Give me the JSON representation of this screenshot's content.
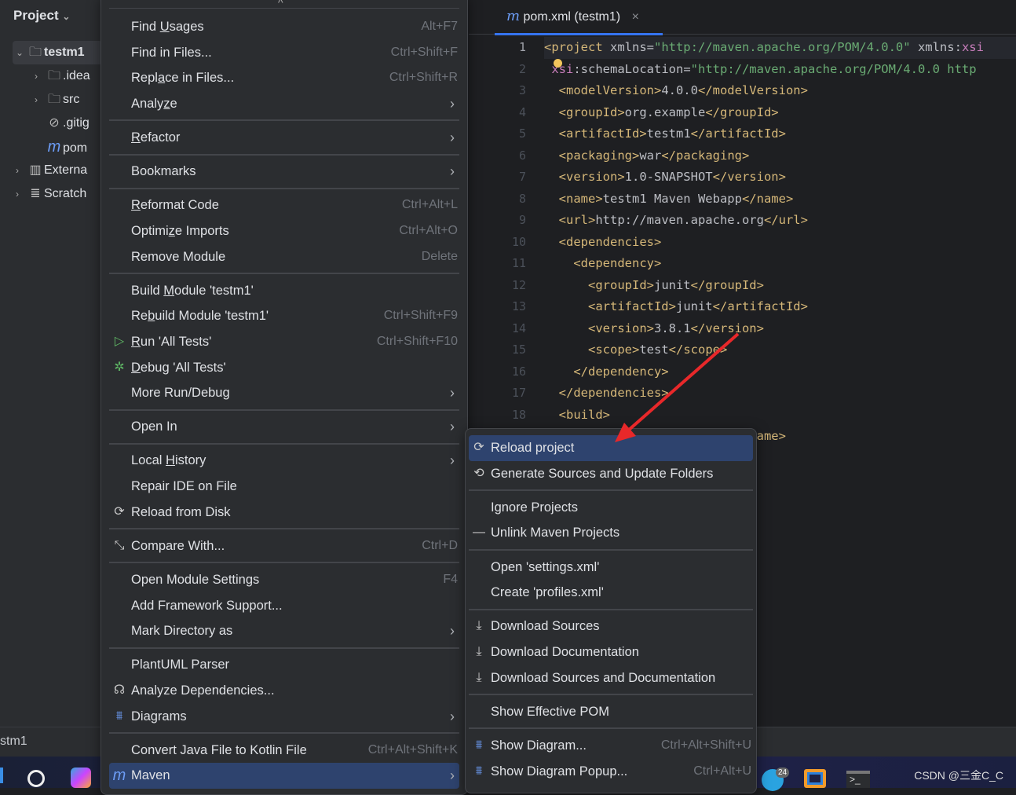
{
  "project_panel": {
    "title": "Project",
    "tree": [
      {
        "label": "testm1",
        "icon": "module-folder-icon",
        "depth": 0,
        "expanded": true,
        "selected": true
      },
      {
        "label": ".idea",
        "icon": "folder-icon",
        "depth": 1,
        "expanded": false
      },
      {
        "label": "src",
        "icon": "folder-icon",
        "depth": 1,
        "expanded": false
      },
      {
        "label": ".gitig",
        "icon": "ignored-file-icon",
        "depth": 1
      },
      {
        "label": "pom",
        "icon": "maven-icon",
        "depth": 1
      },
      {
        "label": "Externa",
        "icon": "library-icon",
        "depth": 0,
        "expanded": false
      },
      {
        "label": "Scratch",
        "icon": "scratch-icon",
        "depth": 0,
        "expanded": false
      }
    ]
  },
  "editor": {
    "tab": {
      "label": "pom.xml (testm1)",
      "icon": "maven-icon",
      "close": "×"
    },
    "lines": [
      [
        [
          "tg",
          "<project"
        ],
        [
          "at",
          " xmlns="
        ],
        [
          "st",
          "\"http://maven.apache.org/POM/4.0.0\""
        ],
        [
          "at",
          " xmlns:"
        ],
        [
          "ns",
          "xsi"
        ]
      ],
      [
        [
          "at",
          " "
        ],
        [
          "ns",
          "xsi"
        ],
        [
          "at",
          ":schemaLocation="
        ],
        [
          "st",
          "\"http://maven.apache.org/POM/4.0.0 http"
        ]
      ],
      [
        [
          "tg",
          "  <modelVersion>"
        ],
        [
          "at",
          "4.0.0"
        ],
        [
          "tg",
          "</modelVersion>"
        ]
      ],
      [
        [
          "tg",
          "  <groupId>"
        ],
        [
          "at",
          "org.example"
        ],
        [
          "tg",
          "</groupId>"
        ]
      ],
      [
        [
          "tg",
          "  <artifactId>"
        ],
        [
          "at",
          "testm1"
        ],
        [
          "tg",
          "</artifactId>"
        ]
      ],
      [
        [
          "tg",
          "  <packaging>"
        ],
        [
          "at",
          "war"
        ],
        [
          "tg",
          "</packaging>"
        ]
      ],
      [
        [
          "tg",
          "  <version>"
        ],
        [
          "at",
          "1.0-SNAPSHOT"
        ],
        [
          "tg",
          "</version>"
        ]
      ],
      [
        [
          "tg",
          "  <name>"
        ],
        [
          "at",
          "testm1 Maven Webapp"
        ],
        [
          "tg",
          "</name>"
        ]
      ],
      [
        [
          "tg",
          "  <url>"
        ],
        [
          "at",
          "http://maven.apache.org"
        ],
        [
          "tg",
          "</url>"
        ]
      ],
      [
        [
          "tg",
          "  <dependencies>"
        ]
      ],
      [
        [
          "tg",
          "    <dependency>"
        ]
      ],
      [
        [
          "tg",
          "      <groupId>"
        ],
        [
          "at",
          "junit"
        ],
        [
          "tg",
          "</groupId>"
        ]
      ],
      [
        [
          "tg",
          "      <artifactId>"
        ],
        [
          "at",
          "junit"
        ],
        [
          "tg",
          "</artifactId>"
        ]
      ],
      [
        [
          "tg",
          "      <version>"
        ],
        [
          "at",
          "3.8.1"
        ],
        [
          "tg",
          "</version>"
        ]
      ],
      [
        [
          "tg",
          "      <scope>"
        ],
        [
          "at",
          "test"
        ],
        [
          "tg",
          "</scope>"
        ]
      ],
      [
        [
          "tg",
          "    </dependency>"
        ]
      ],
      [
        [
          "tg",
          "  </dependencies>"
        ]
      ],
      [
        [
          "tg",
          "  <build>"
        ]
      ],
      [
        [
          "at",
          "                           "
        ],
        [
          "tg",
          "lName>"
        ]
      ]
    ]
  },
  "status": {
    "text": "stm1"
  },
  "taskbar": {
    "label": "CSDN @三金C_C",
    "badge": "24"
  },
  "context_menu": {
    "items": [
      {
        "label": "Find Usages",
        "u": 5,
        "shortcut": "Alt+F7"
      },
      {
        "label": "Find in Files...",
        "shortcut": "Ctrl+Shift+F"
      },
      {
        "label": "Replace in Files...",
        "u": 4,
        "shortcut": "Ctrl+Shift+R"
      },
      {
        "label": "Analyze",
        "u": 5,
        "submenu": true
      },
      {
        "sep": true
      },
      {
        "label": "Refactor",
        "u": 0,
        "submenu": true
      },
      {
        "sep": true
      },
      {
        "label": "Bookmarks",
        "submenu": true
      },
      {
        "sep": true
      },
      {
        "label": "Reformat Code",
        "u": 0,
        "shortcut": "Ctrl+Alt+L"
      },
      {
        "label": "Optimize Imports",
        "u": 6,
        "shortcut": "Ctrl+Alt+O"
      },
      {
        "label": "Remove Module",
        "shortcut": "Delete"
      },
      {
        "sep": true
      },
      {
        "label": "Build Module 'testm1'",
        "u": 6
      },
      {
        "label": "Rebuild Module 'testm1'",
        "u": 2,
        "shortcut": "Ctrl+Shift+F9"
      },
      {
        "label": "Run 'All Tests'",
        "u": 0,
        "shortcut": "Ctrl+Shift+F10",
        "icon": "run-icon"
      },
      {
        "label": "Debug 'All Tests'",
        "u": 0,
        "icon": "debug-icon"
      },
      {
        "label": "More Run/Debug",
        "submenu": true
      },
      {
        "sep": true
      },
      {
        "label": "Open In",
        "submenu": true
      },
      {
        "sep": true
      },
      {
        "label": "Local History",
        "u": 6,
        "submenu": true
      },
      {
        "label": "Repair IDE on File"
      },
      {
        "label": "Reload from Disk",
        "icon": "reload-icon"
      },
      {
        "sep": true
      },
      {
        "label": "Compare With...",
        "shortcut": "Ctrl+D",
        "icon": "compare-icon"
      },
      {
        "sep": true
      },
      {
        "label": "Open Module Settings",
        "shortcut": "F4"
      },
      {
        "label": "Add Framework Support..."
      },
      {
        "label": "Mark Directory as",
        "submenu": true
      },
      {
        "sep": true
      },
      {
        "label": "PlantUML Parser"
      },
      {
        "label": "Analyze Dependencies...",
        "icon": "dependencies-icon"
      },
      {
        "label": "Diagrams",
        "submenu": true,
        "icon": "diagram-icon"
      },
      {
        "sep": true
      },
      {
        "label": "Convert Java File to Kotlin File",
        "shortcut": "Ctrl+Alt+Shift+K"
      },
      {
        "label": "Maven",
        "submenu": true,
        "icon": "maven-icon",
        "highlighted": true
      }
    ]
  },
  "maven_submenu": {
    "items": [
      {
        "label": "Reload project",
        "icon": "reload-icon",
        "highlighted": true
      },
      {
        "label": "Generate Sources and Update Folders",
        "icon": "generate-sources-icon"
      },
      {
        "sep": true
      },
      {
        "label": "Ignore Projects"
      },
      {
        "label": "Unlink Maven Projects",
        "icon": "minus-icon"
      },
      {
        "sep": true
      },
      {
        "label": "Open 'settings.xml'"
      },
      {
        "label": "Create 'profiles.xml'"
      },
      {
        "sep": true
      },
      {
        "label": "Download Sources",
        "icon": "download-icon"
      },
      {
        "label": "Download Documentation",
        "icon": "download-icon"
      },
      {
        "label": "Download Sources and Documentation",
        "icon": "download-icon"
      },
      {
        "sep": true
      },
      {
        "label": "Show Effective POM"
      },
      {
        "sep": true
      },
      {
        "label": "Show Diagram...",
        "icon": "diagram-icon",
        "shortcut": "Ctrl+Alt+Shift+U"
      },
      {
        "label": "Show Diagram Popup...",
        "icon": "diagram-icon",
        "shortcut": "Ctrl+Alt+U"
      }
    ]
  },
  "colors": {
    "accent": "#3574f0",
    "highlight": "#2e436e",
    "arrow": "#e8282a",
    "menu_bg": "#2b2d30"
  }
}
